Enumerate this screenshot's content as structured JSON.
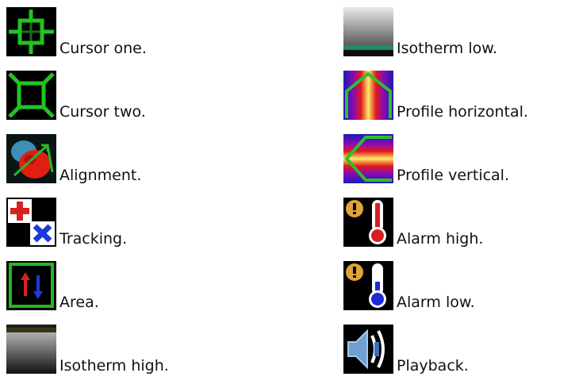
{
  "left_column": [
    {
      "icon": "cursor-one-icon",
      "label": "Cursor one."
    },
    {
      "icon": "cursor-two-icon",
      "label": "Cursor two."
    },
    {
      "icon": "alignment-icon",
      "label": "Alignment."
    },
    {
      "icon": "tracking-icon",
      "label": "Tracking."
    },
    {
      "icon": "area-icon",
      "label": "Area."
    },
    {
      "icon": "isotherm-high-icon",
      "label": "Isotherm high."
    }
  ],
  "right_column": [
    {
      "icon": "isotherm-low-icon",
      "label": "Isotherm low."
    },
    {
      "icon": "profile-horizontal-icon",
      "label": "Profile horizontal."
    },
    {
      "icon": "profile-vertical-icon",
      "label": "Profile vertical."
    },
    {
      "icon": "alarm-high-icon",
      "label": "Alarm high."
    },
    {
      "icon": "alarm-low-icon",
      "label": "Alarm low."
    },
    {
      "icon": "playback-icon",
      "label": "Playback."
    }
  ],
  "colors": {
    "icon_background": "#000000",
    "cursor_green": "#22c322",
    "alarm_high": "#d81e1e",
    "alarm_low": "#1e2ad8",
    "alarm_bell": "#e0a23a",
    "tracking_red": "#d42323",
    "tracking_blue": "#1a3ad6"
  }
}
